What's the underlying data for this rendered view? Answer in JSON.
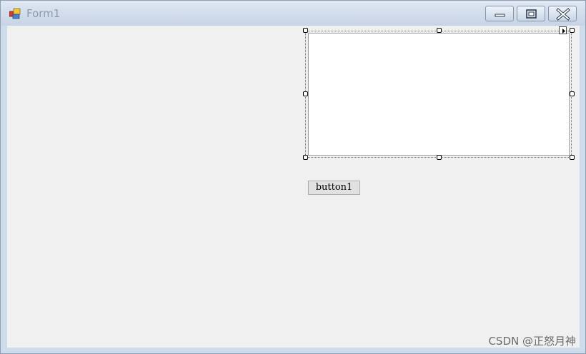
{
  "window": {
    "title": "Form1",
    "icon": "form-app-icon"
  },
  "caption_buttons": {
    "minimize": "minimize-icon",
    "maximize": "maximize-icon",
    "close": "close-icon"
  },
  "form": {
    "button_label": "button1",
    "picture_box": "selected-picturebox",
    "smart_tag": "smart-tag-arrow-icon"
  },
  "watermark": {
    "text": "CSDN @正怒月神"
  },
  "colors": {
    "client_background": "#f0f0f0",
    "titlebar": "#cfdcec"
  }
}
